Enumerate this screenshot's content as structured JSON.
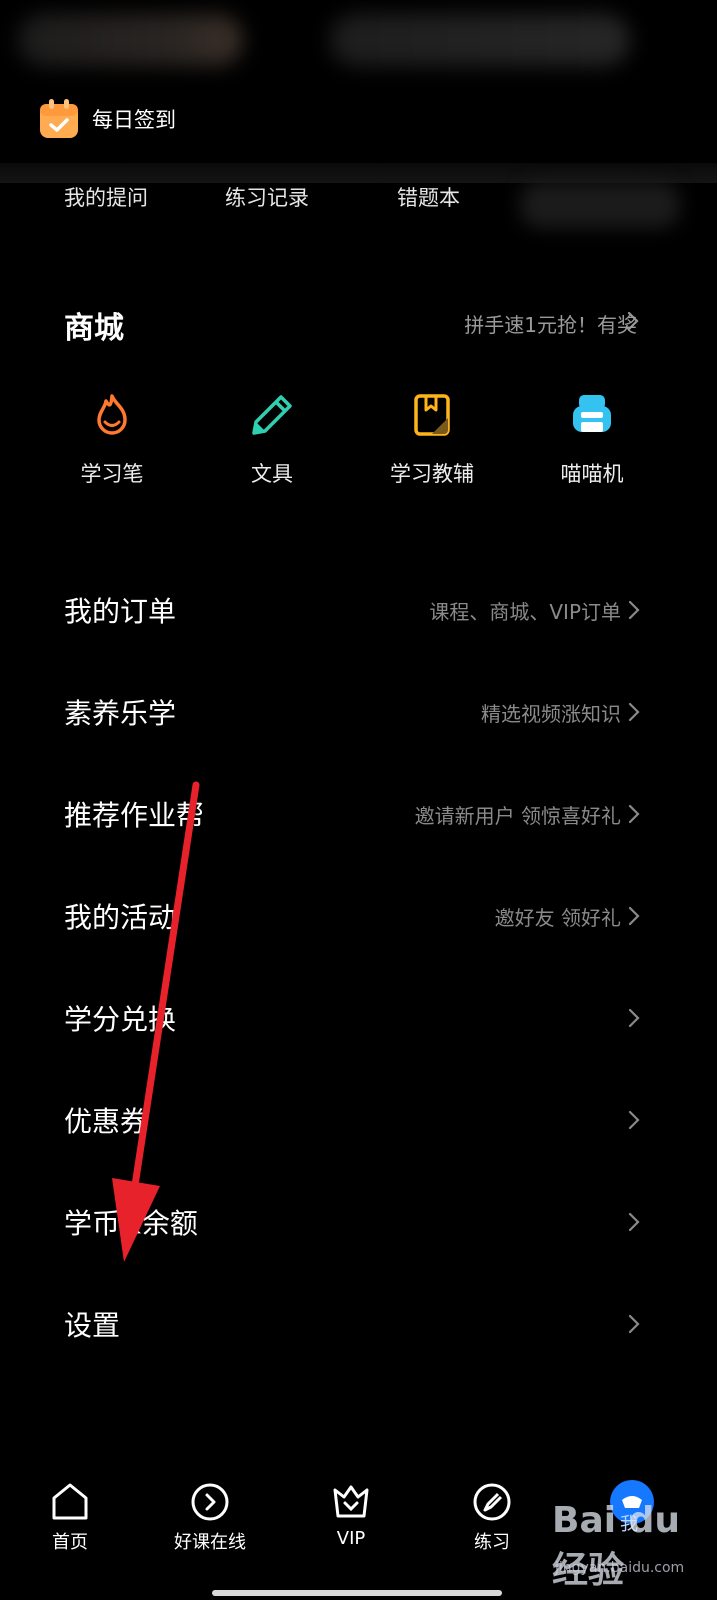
{
  "signin": {
    "label": "每日签到"
  },
  "quick_links": [
    "我的提问",
    "练习记录",
    "错题本"
  ],
  "mall": {
    "title": "商城",
    "promo": "拼手速1元抢！有奖",
    "items": [
      {
        "label": "学习笔",
        "icon": "flame-icon",
        "color": "#ff7a2e"
      },
      {
        "label": "文具",
        "icon": "pen-icon",
        "color": "#2fd0b0"
      },
      {
        "label": "学习教辅",
        "icon": "book-icon",
        "color": "#ffb51a"
      },
      {
        "label": "喵喵机",
        "icon": "printer-icon",
        "color": "#34c2f0"
      }
    ]
  },
  "menu": [
    {
      "title": "我的订单",
      "sub": "课程、商城、VIP订单"
    },
    {
      "title": "素养乐学",
      "sub": "精选视频涨知识"
    },
    {
      "title": "推荐作业帮",
      "sub": "邀请新用户 领惊喜好礼"
    },
    {
      "title": "我的活动",
      "sub": "邀好友 领好礼"
    },
    {
      "title": "学分兑换",
      "sub": ""
    },
    {
      "title": "优惠券",
      "sub": ""
    },
    {
      "title": "学币&余额",
      "sub": ""
    },
    {
      "title": "设置",
      "sub": ""
    }
  ],
  "nav": [
    {
      "label": "首页",
      "icon": "home-icon"
    },
    {
      "label": "好课在线",
      "icon": "play-circle-icon"
    },
    {
      "label": "VIP",
      "icon": "vip-crown-icon"
    },
    {
      "label": "练习",
      "icon": "compass-icon"
    },
    {
      "label": "我",
      "icon": "profile-icon"
    }
  ],
  "watermark": {
    "logo": "Bai du 经验",
    "url": "jingyan.baidu.com"
  },
  "colors": {
    "background": "#000000",
    "annotation_arrow": "#e8222a",
    "active_nav": "#1677ff"
  }
}
